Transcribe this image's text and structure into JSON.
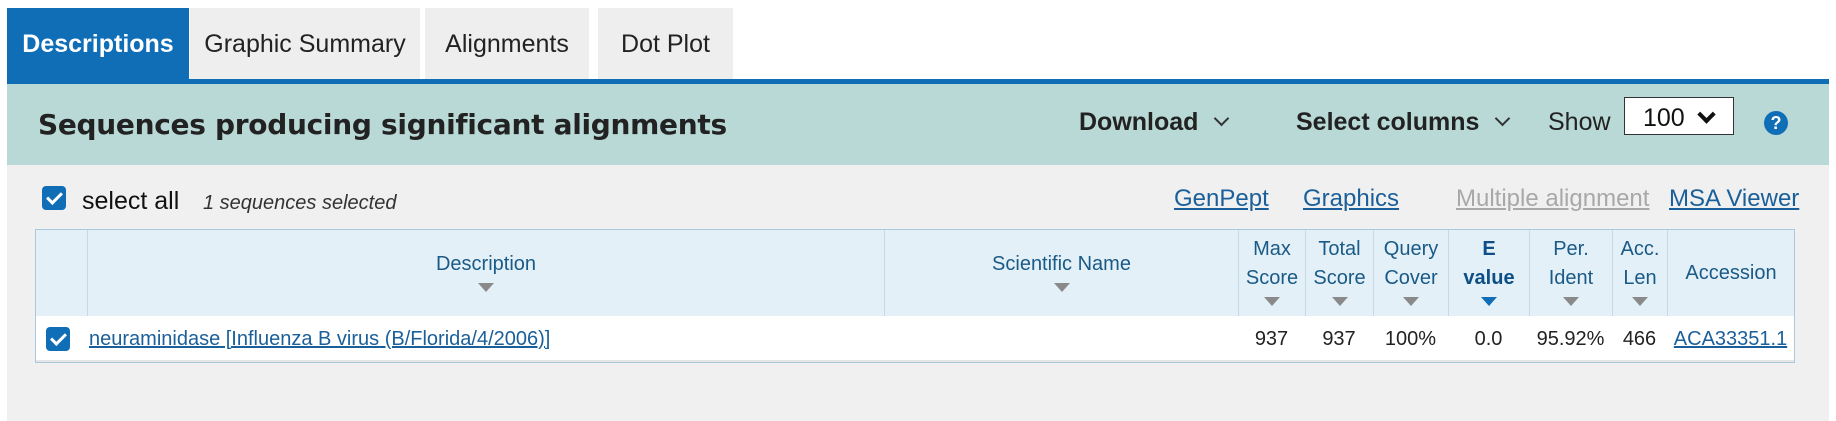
{
  "tabs": [
    {
      "label": "Descriptions",
      "active": true
    },
    {
      "label": "Graphic Summary",
      "active": false
    },
    {
      "label": "Alignments",
      "active": false
    },
    {
      "label": "Dot Plot",
      "active": false
    }
  ],
  "header": {
    "title": "Sequences producing significant alignments",
    "download_label": "Download",
    "select_columns_label": "Select columns",
    "show_label": "Show",
    "show_value": "100",
    "help_symbol": "?"
  },
  "toolbar": {
    "select_all_label": "select all",
    "selected_count": "1 sequences selected",
    "select_all_checked": true,
    "links": {
      "genpept": "GenPept",
      "graphics": "Graphics",
      "multiple_alignment": "Multiple alignment",
      "msa_viewer": "MSA Viewer"
    }
  },
  "table": {
    "columns": {
      "description": "Description",
      "scientific_name": "Scientific Name",
      "max_score": [
        "Max",
        "Score"
      ],
      "total_score": [
        "Total",
        "Score"
      ],
      "query_cover": [
        "Query",
        "Cover"
      ],
      "e_value": [
        "E",
        "value"
      ],
      "per_ident": [
        "Per.",
        "Ident"
      ],
      "acc_len": [
        "Acc.",
        "Len"
      ],
      "accession": "Accession"
    },
    "rows": [
      {
        "checked": true,
        "description": "neuraminidase [Influenza B virus (B/Florida/4/2006)]",
        "scientific_name": "",
        "max_score": "937",
        "total_score": "937",
        "query_cover": "100%",
        "e_value": "0.0",
        "per_ident": "95.92%",
        "acc_len": "466",
        "accession": "ACA33351.1"
      }
    ]
  },
  "colors": {
    "accent": "#0f6eb6",
    "header_band": "#b9d9d6",
    "table_header": "#e3f0f8",
    "link": "#1a5f99",
    "disabled_link": "#a8a8a8"
  }
}
